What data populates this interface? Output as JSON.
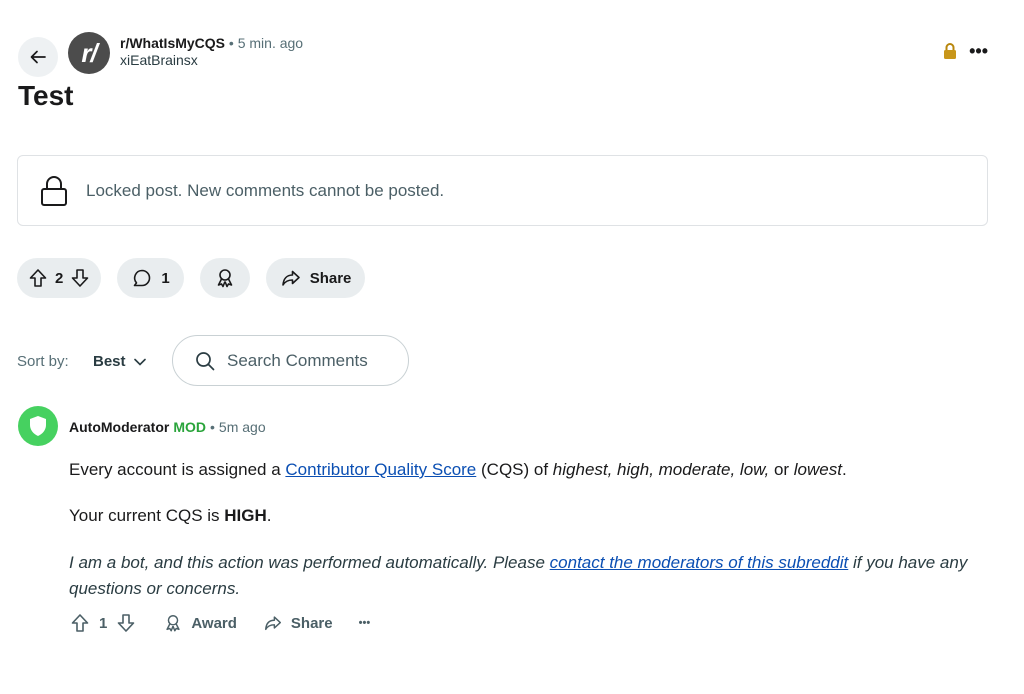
{
  "post": {
    "subreddit": "r/WhatIsMyCQS",
    "subreddit_avatar": "r/",
    "separator": "•",
    "time": "5 min. ago",
    "author": "xiEatBrainsx",
    "title": "Test",
    "locked_message": "Locked post. New comments cannot be posted.",
    "more_label": "•••",
    "score": "2",
    "comment_count": "1",
    "share_label": "Share",
    "accent_lock_color": "#b8860b"
  },
  "comments_controls": {
    "sort_label": "Sort by:",
    "sort_value": "Best",
    "search_placeholder": "Search Comments"
  },
  "comment": {
    "author": "AutoModerator",
    "mod_badge": "MOD",
    "separator": "•",
    "time": "5m ago",
    "line1_prefix": "Every account is assigned a ",
    "line1_link": "Contributor Quality Score",
    "line1_mid": " (CQS) of ",
    "line1_levels_a": "highest, high, moderate, low,",
    "line1_or": " or ",
    "line1_levels_b": "lowest",
    "line1_end": ".",
    "line2_prefix": "Your current CQS is ",
    "line2_value": "HIGH",
    "line2_end": ".",
    "line3_prefix": "I am a bot, and this action was performed automatically. Please ",
    "line3_link": "contact the moderators of this subreddit",
    "line3_suffix": " if you have any questions or concerns.",
    "score": "1",
    "award_label": "Award",
    "share_label": "Share",
    "more_label": "•••",
    "avatar_color": "#46d160"
  }
}
